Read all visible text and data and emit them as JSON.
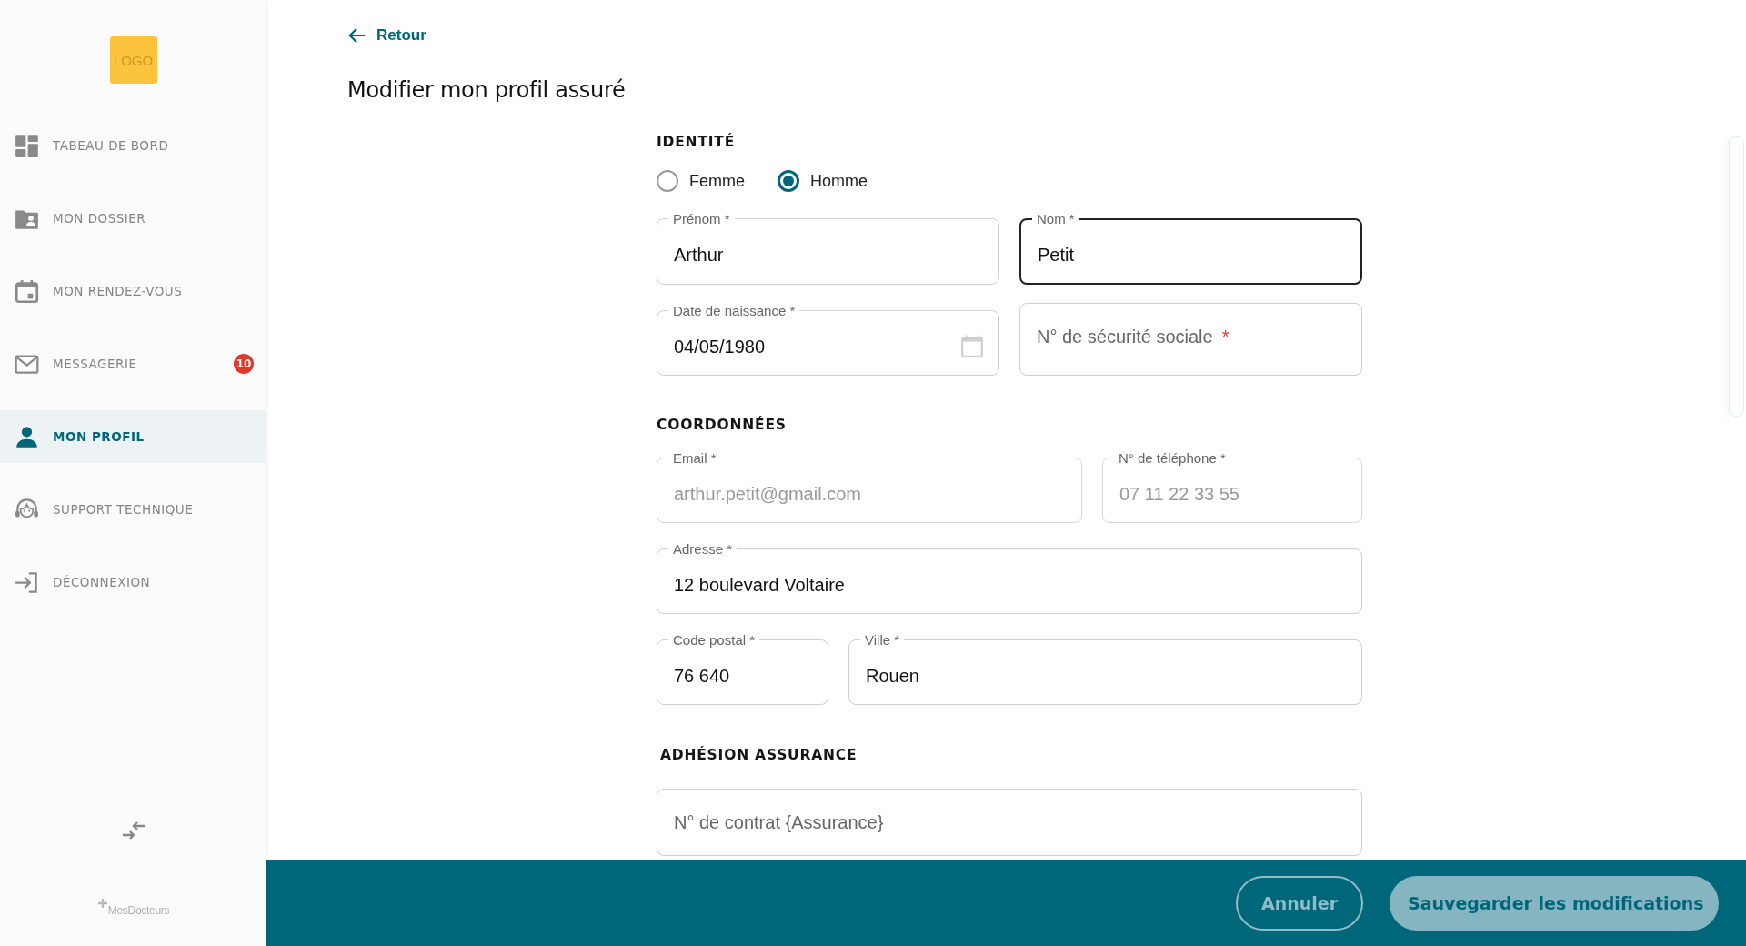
{
  "logo": {
    "text": "LOGO"
  },
  "nav": [
    {
      "label": "TABEAU DE BORD",
      "selected": false
    },
    {
      "label": "MON DOSSIER",
      "selected": false
    },
    {
      "label": "MON RENDEZ-VOUS",
      "selected": false
    },
    {
      "label": "MESSAGERIE",
      "selected": false,
      "badge": "10"
    },
    {
      "label": "MON PROFIL",
      "selected": true
    },
    {
      "label": "SUPPORT TECHNIQUE",
      "selected": false
    },
    {
      "label": "DÉCONNEXION",
      "selected": false
    }
  ],
  "brand": {
    "name": "MesDocteurs"
  },
  "back_link": {
    "label": "Retour"
  },
  "page_title": "Modifier mon profil assuré",
  "sections": [
    {
      "title": "IDENTITÉ",
      "radios": [
        {
          "label": "Femme",
          "selected": false
        },
        {
          "label": "Homme",
          "selected": true
        }
      ],
      "rows": [
        [
          {
            "kind": "text",
            "label": "Prénom *",
            "value": "Arthur",
            "focused": false,
            "disabled": false
          },
          {
            "kind": "text",
            "label": "Nom *",
            "value": "Petit",
            "focused": true,
            "disabled": false
          }
        ],
        [
          {
            "kind": "date",
            "label": "Date de naissance *",
            "value": "04/05/1980",
            "focused": false,
            "disabled": false
          },
          {
            "kind": "text",
            "placeholder": "N° de sécurité sociale",
            "required_mark": "*",
            "focused": false,
            "disabled": false
          }
        ]
      ]
    },
    {
      "title": "COORDONNÉES",
      "rows": [
        [
          {
            "kind": "text",
            "label": "Email *",
            "value": "arthur.petit@gmail.com",
            "focused": false,
            "disabled": true
          },
          {
            "kind": "text",
            "label": "N° de téléphone *",
            "value": "07 11 22 33 55",
            "focused": false,
            "disabled": true
          }
        ],
        [
          {
            "kind": "text",
            "label": "Adresse *",
            "value": "12 boulevard Voltaire",
            "focused": false,
            "disabled": false
          }
        ],
        [
          {
            "kind": "text",
            "label": "Code postal *",
            "value": "76 640",
            "focused": false,
            "disabled": false
          },
          {
            "kind": "text",
            "label": "Ville *",
            "value": "Rouen",
            "focused": false,
            "disabled": false
          }
        ]
      ]
    },
    {
      "title": "ADHÉSION ASSURANCE",
      "rows": [
        [
          {
            "kind": "text",
            "placeholder": "N° de contrat {Assurance}",
            "focused": false,
            "disabled": false
          }
        ]
      ]
    }
  ],
  "actions": [
    {
      "label": "Annuler",
      "kind": "secondary"
    },
    {
      "label": "Sauvegarder les modifications",
      "kind": "primary"
    }
  ]
}
